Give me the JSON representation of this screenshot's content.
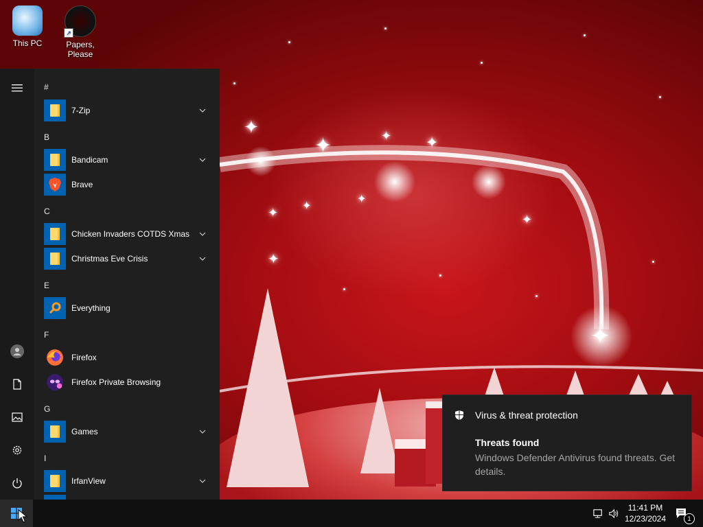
{
  "desktop": {
    "icons": [
      {
        "label": "This PC",
        "icon": "this-pc-icon"
      },
      {
        "label": "Papers, Please",
        "icon": "papers-please-icon"
      }
    ]
  },
  "start_menu": {
    "rail": {
      "icons": [
        "hamburger-menu-icon",
        "user-account-icon",
        "documents-icon",
        "pictures-icon",
        "settings-icon",
        "power-icon"
      ]
    },
    "groups": [
      {
        "letter": "#",
        "apps": [
          {
            "name": "7-Zip",
            "icon": "folder-icon",
            "expandable": true
          }
        ]
      },
      {
        "letter": "B",
        "apps": [
          {
            "name": "Bandicam",
            "icon": "folder-icon",
            "expandable": true
          },
          {
            "name": "Brave",
            "icon": "brave-icon",
            "expandable": false
          }
        ]
      },
      {
        "letter": "C",
        "apps": [
          {
            "name": "Chicken Invaders COTDS Xmas",
            "icon": "folder-icon",
            "expandable": true
          },
          {
            "name": "Christmas Eve Crisis",
            "icon": "folder-icon",
            "expandable": true
          }
        ]
      },
      {
        "letter": "E",
        "apps": [
          {
            "name": "Everything",
            "icon": "everything-search-icon",
            "expandable": false
          }
        ]
      },
      {
        "letter": "F",
        "apps": [
          {
            "name": "Firefox",
            "icon": "firefox-icon",
            "expandable": false
          },
          {
            "name": "Firefox Private Browsing",
            "icon": "firefox-private-icon",
            "expandable": false
          }
        ]
      },
      {
        "letter": "G",
        "apps": [
          {
            "name": "Games",
            "icon": "folder-icon",
            "expandable": true
          }
        ]
      },
      {
        "letter": "I",
        "apps": [
          {
            "name": "IrfanView",
            "icon": "folder-icon",
            "expandable": true
          }
        ]
      }
    ]
  },
  "toast": {
    "title": "Virus & threat protection",
    "heading": "Threats found",
    "body": "Windows Defender Antivirus found threats. Get details."
  },
  "taskbar": {
    "time": "11:41 PM",
    "date": "12/23/2024",
    "notification_count": "1"
  },
  "colors": {
    "accent": "#0063b1",
    "menu_bg": "#1f1f1f",
    "taskbar_bg": "#101010",
    "wallpaper": "#b0111a"
  }
}
